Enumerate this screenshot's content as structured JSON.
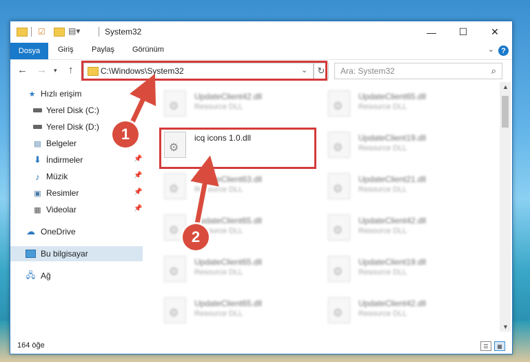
{
  "window": {
    "title": "System32"
  },
  "window_controls": {
    "minimize": "—",
    "maximize": "☐",
    "close": "✕"
  },
  "ribbon": {
    "file_tab": "Dosya",
    "tabs": [
      "Giriş",
      "Paylaş",
      "Görünüm"
    ],
    "help": "?"
  },
  "address_bar": {
    "path": "C:\\Windows\\System32"
  },
  "search": {
    "placeholder": "Ara: System32"
  },
  "sidebar": {
    "items": [
      {
        "label": "Hızlı erişim",
        "icon": "star-icon"
      },
      {
        "label": "Yerel Disk (C:)",
        "icon": "drive-icon"
      },
      {
        "label": "Yerel Disk (D:)",
        "icon": "drive-icon"
      },
      {
        "label": "Belgeler",
        "icon": "documents-icon"
      },
      {
        "label": "İndirmeler",
        "icon": "download-icon"
      },
      {
        "label": "Müzik",
        "icon": "music-icon"
      },
      {
        "label": "Resimler",
        "icon": "pictures-icon"
      },
      {
        "label": "Videolar",
        "icon": "videos-icon"
      },
      {
        "label": "OneDrive",
        "icon": "cloud-icon"
      },
      {
        "label": "Bu bilgisayar",
        "icon": "computer-icon"
      },
      {
        "label": "Ağ",
        "icon": "network-icon"
      }
    ]
  },
  "files": [
    {
      "name": "UpdateClient42.dll",
      "type": "Resource DLL"
    },
    {
      "name": "UpdateClient65.dll",
      "type": "Resource DLL"
    },
    {
      "name": "icq icons 1.0.dll",
      "type": ""
    },
    {
      "name": "UpdateClient19.dll",
      "type": "Resource DLL"
    },
    {
      "name": "UpdateClient63.dll",
      "type": "Resource DLL"
    },
    {
      "name": "UpdateClient21.dll",
      "type": "Resource DLL"
    },
    {
      "name": "UpdateClient65.dll",
      "type": "Resource DLL"
    },
    {
      "name": "UpdateClient42.dll",
      "type": "Resource DLL"
    },
    {
      "name": "UpdateClient65.dll",
      "type": "Resource DLL"
    },
    {
      "name": "UpdateClient19.dll",
      "type": "Resource DLL"
    },
    {
      "name": "UpdateClient65.dll",
      "type": "Resource DLL"
    },
    {
      "name": "UpdateClient42.dll",
      "type": "Resource DLL"
    }
  ],
  "status": {
    "count": "164 öğe"
  },
  "annotations": {
    "step1": "1",
    "step2": "2",
    "color": "#d94c3d"
  }
}
